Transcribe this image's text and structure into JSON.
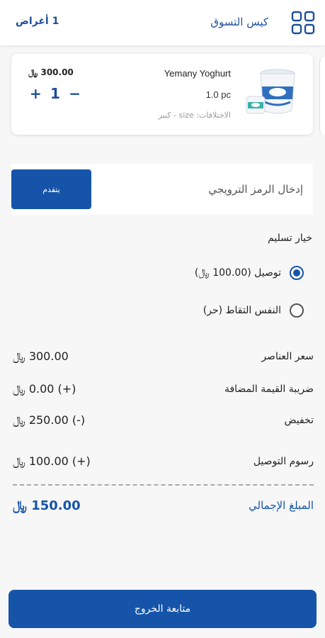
{
  "header": {
    "title": "كيس التسوق",
    "items_count": "1 أغراض",
    "menu_icon": "grid-icon"
  },
  "cart_item": {
    "name": "Yemany Yoghurt",
    "quantity_unit": "1.0 pc",
    "variation": "الاختلافات: size - كبير",
    "price": "300.00 ﷼",
    "quantity": "1",
    "plus": "+",
    "minus": "−",
    "image_icon": "yogurt-cup-image"
  },
  "coupon": {
    "placeholder": "إدخال الرمز الترويجي",
    "apply_label": "يتقدم"
  },
  "delivery": {
    "title": "خيار تسليم",
    "options": [
      {
        "label": "توصيل (100.00 ﷼)",
        "selected": true
      },
      {
        "label": "النفس التقاط (حر)",
        "selected": false
      }
    ]
  },
  "summary": {
    "items_price_label": "سعر العناصر",
    "items_price_value": "300.00 ﷼",
    "vat_label": "ضريبة القيمة المضافة",
    "vat_value": "(+) 0.00 ﷼",
    "discount_label": "تخفيض",
    "discount_value": "(-) 250.00 ﷼",
    "delivery_fee_label": "رسوم التوصيل",
    "delivery_fee_value": "(+) 100.00 ﷼",
    "total_label": "المبلغ الإجمالي",
    "total_value": "150.00 ﷼"
  },
  "checkout": {
    "label": "متابعة الخروج"
  },
  "colors": {
    "accent": "#1554a8",
    "header_text": "#1d4f9a",
    "background": "#f7f7f8"
  }
}
